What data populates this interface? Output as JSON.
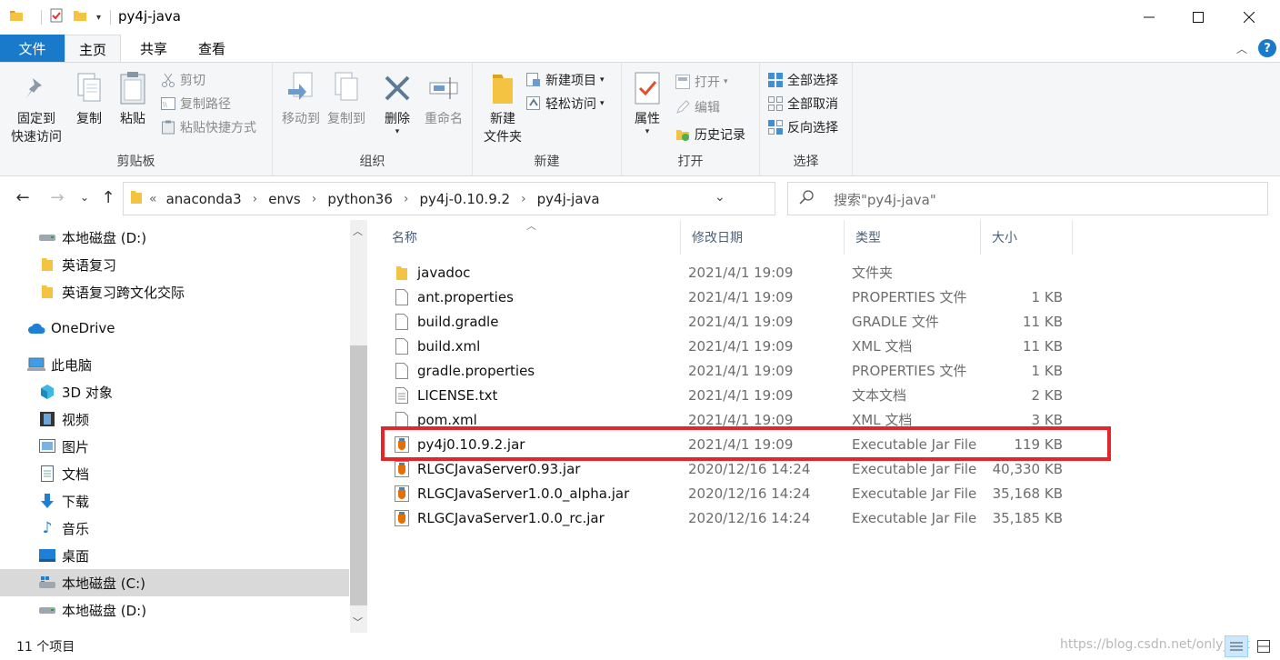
{
  "window": {
    "title": "py4j-java"
  },
  "tabs": [
    {
      "label": "文件"
    },
    {
      "label": "主页"
    },
    {
      "label": "共享"
    },
    {
      "label": "查看"
    }
  ],
  "ribbon": {
    "clipboard": {
      "group_label": "剪贴板",
      "pin_line1": "固定到",
      "pin_line2": "快速访问",
      "copy": "复制",
      "paste": "粘贴",
      "cut": "剪切",
      "copy_path": "复制路径",
      "paste_shortcut": "粘贴快捷方式"
    },
    "organize": {
      "group_label": "组织",
      "move_to": "移动到",
      "copy_to": "复制到",
      "delete": "删除",
      "rename": "重命名"
    },
    "new": {
      "group_label": "新建",
      "new_folder_line1": "新建",
      "new_folder_line2": "文件夹",
      "new_item": "新建项目",
      "easy_access": "轻松访问"
    },
    "open": {
      "group_label": "打开",
      "properties": "属性",
      "open": "打开",
      "edit": "编辑",
      "history": "历史记录"
    },
    "select": {
      "group_label": "选择",
      "select_all": "全部选择",
      "select_none": "全部取消",
      "invert": "反向选择"
    }
  },
  "address": {
    "crumbs": [
      "anaconda3",
      "envs",
      "python36",
      "py4j-0.10.9.2",
      "py4j-java"
    ],
    "search_placeholder": "搜索\"py4j-java\""
  },
  "nav": {
    "items": [
      {
        "label": "本地磁盘 (D:)"
      },
      {
        "label": "英语复习"
      },
      {
        "label": "英语复习跨文化交际"
      },
      {
        "label": "OneDrive"
      },
      {
        "label": "此电脑"
      },
      {
        "label": "3D 对象"
      },
      {
        "label": "视频"
      },
      {
        "label": "图片"
      },
      {
        "label": "文档"
      },
      {
        "label": "下载"
      },
      {
        "label": "音乐"
      },
      {
        "label": "桌面"
      },
      {
        "label": "本地磁盘 (C:)"
      },
      {
        "label": "本地磁盘 (D:)"
      }
    ]
  },
  "columns": {
    "name": "名称",
    "date": "修改日期",
    "type": "类型",
    "size": "大小"
  },
  "files": [
    {
      "name": "javadoc",
      "date": "2021/4/1 19:09",
      "type": "文件夹",
      "size": ""
    },
    {
      "name": "ant.properties",
      "date": "2021/4/1 19:09",
      "type": "PROPERTIES 文件",
      "size": "1 KB"
    },
    {
      "name": "build.gradle",
      "date": "2021/4/1 19:09",
      "type": "GRADLE 文件",
      "size": "11 KB"
    },
    {
      "name": "build.xml",
      "date": "2021/4/1 19:09",
      "type": "XML 文档",
      "size": "11 KB"
    },
    {
      "name": "gradle.properties",
      "date": "2021/4/1 19:09",
      "type": "PROPERTIES 文件",
      "size": "1 KB"
    },
    {
      "name": "LICENSE.txt",
      "date": "2021/4/1 19:09",
      "type": "文本文档",
      "size": "2 KB"
    },
    {
      "name": "pom.xml",
      "date": "2021/4/1 19:09",
      "type": "XML 文档",
      "size": "3 KB"
    },
    {
      "name": "py4j0.10.9.2.jar",
      "date": "2021/4/1 19:09",
      "type": "Executable Jar File",
      "size": "119 KB"
    },
    {
      "name": "RLGCJavaServer0.93.jar",
      "date": "2020/12/16 14:24",
      "type": "Executable Jar File",
      "size": "40,330 KB"
    },
    {
      "name": "RLGCJavaServer1.0.0_alpha.jar",
      "date": "2020/12/16 14:24",
      "type": "Executable Jar File",
      "size": "35,168 KB"
    },
    {
      "name": "RLGCJavaServer1.0.0_rc.jar",
      "date": "2020/12/16 14:24",
      "type": "Executable Jar File",
      "size": "35,185 KB"
    }
  ],
  "status": {
    "count": "11 个项目",
    "watermark": "https://blog.csdn.net/only_pyt"
  },
  "colors": {
    "file_tab": "#1979ca",
    "highlight": "#e8242b",
    "folder": "#f5c342"
  }
}
